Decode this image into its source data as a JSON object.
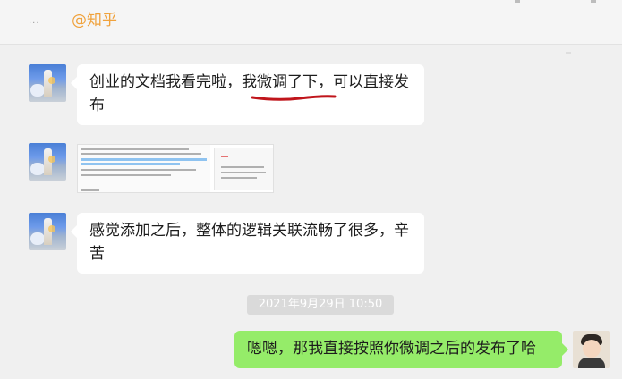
{
  "header": {
    "chat_name": "...",
    "watermark": "@知乎"
  },
  "messages": [
    {
      "side": "left",
      "text_before": "创业的文档我看完啦，",
      "text_underlined": "我微调了下",
      "text_after": "，可以直接发布"
    },
    {
      "side": "left",
      "type": "image"
    },
    {
      "side": "left",
      "text": "感觉添加之后，整体的逻辑关联流畅了很多，辛苦"
    }
  ],
  "timestamp": "2021年9月29日 10:50",
  "reply": {
    "side": "right",
    "text": "嗯嗯，那我直接按照你微调之后的发布了哈"
  },
  "colors": {
    "background": "#f0f0f0",
    "bubble_left": "#ffffff",
    "bubble_right": "#95ec69",
    "annotation_underline": "#c0151b",
    "watermark": "#f0a23c"
  },
  "icons": [
    "group-avatar-icon",
    "user-avatar-icon"
  ]
}
